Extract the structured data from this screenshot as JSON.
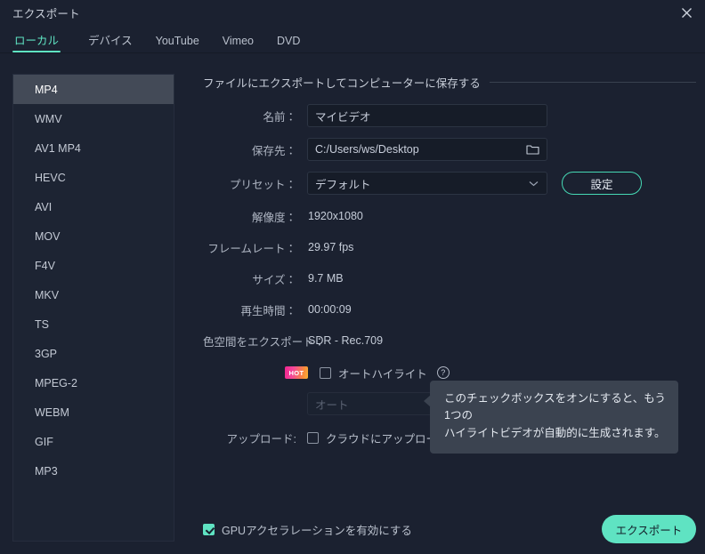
{
  "window": {
    "title": "エクスポート",
    "close_icon": "close-icon"
  },
  "tabs": [
    {
      "label": "ローカル",
      "active": true
    },
    {
      "label": "デバイス",
      "active": false
    },
    {
      "label": "YouTube",
      "active": false
    },
    {
      "label": "Vimeo",
      "active": false
    },
    {
      "label": "DVD",
      "active": false
    }
  ],
  "formats": [
    {
      "label": "MP4",
      "selected": true
    },
    {
      "label": "WMV",
      "selected": false
    },
    {
      "label": "AV1 MP4",
      "selected": false
    },
    {
      "label": "HEVC",
      "selected": false
    },
    {
      "label": "AVI",
      "selected": false
    },
    {
      "label": "MOV",
      "selected": false
    },
    {
      "label": "F4V",
      "selected": false
    },
    {
      "label": "MKV",
      "selected": false
    },
    {
      "label": "TS",
      "selected": false
    },
    {
      "label": "3GP",
      "selected": false
    },
    {
      "label": "MPEG-2",
      "selected": false
    },
    {
      "label": "WEBM",
      "selected": false
    },
    {
      "label": "GIF",
      "selected": false
    },
    {
      "label": "MP3",
      "selected": false
    }
  ],
  "main": {
    "section_title": "ファイルにエクスポートしてコンピューターに保存する",
    "name": {
      "label": "名前：",
      "value": "マイビデオ"
    },
    "destination": {
      "label": "保存先：",
      "value": "C:/Users/ws/Desktop",
      "browse_icon": "folder-icon"
    },
    "preset": {
      "label": "プリセット：",
      "value": "デフォルト",
      "settings_button": "設定"
    },
    "resolution": {
      "label": "解像度：",
      "value": "1920x1080"
    },
    "framerate": {
      "label": "フレームレート：",
      "value": "29.97 fps"
    },
    "size": {
      "label": "サイズ：",
      "value": "9.7 MB"
    },
    "duration": {
      "label": "再生時間：",
      "value": "00:00:09"
    },
    "colorspace": {
      "label": "色空間をエクスポート：",
      "value": "SDR - Rec.709"
    },
    "highlight": {
      "badge": "HOT",
      "label": "オートハイライト",
      "checked": false,
      "help_icon": "help-icon"
    },
    "auto_select": {
      "value": "オート",
      "disabled": true
    },
    "upload": {
      "label": "アップロード:",
      "checkbox_label": "クラウドにアップロード",
      "checked": false,
      "help_icon": "help-icon"
    }
  },
  "tooltip": {
    "line1": "このチェックボックスをオンにすると、もう1つの",
    "line2": "ハイライトビデオが自動的に生成されます。"
  },
  "footer": {
    "gpu_label": "GPUアクセラレーションを有効にする",
    "gpu_checked": true,
    "export_label": "エクスポート"
  },
  "colors": {
    "accent": "#5fe3c2",
    "window_bg": "#1b2130",
    "panel_bg": "#1d2433",
    "field_bg": "#161c28",
    "selected_row": "#434a57",
    "tooltip_bg": "#3b4350",
    "hot_gradient_start": "#f0258f",
    "hot_gradient_end": "#f9b233"
  }
}
